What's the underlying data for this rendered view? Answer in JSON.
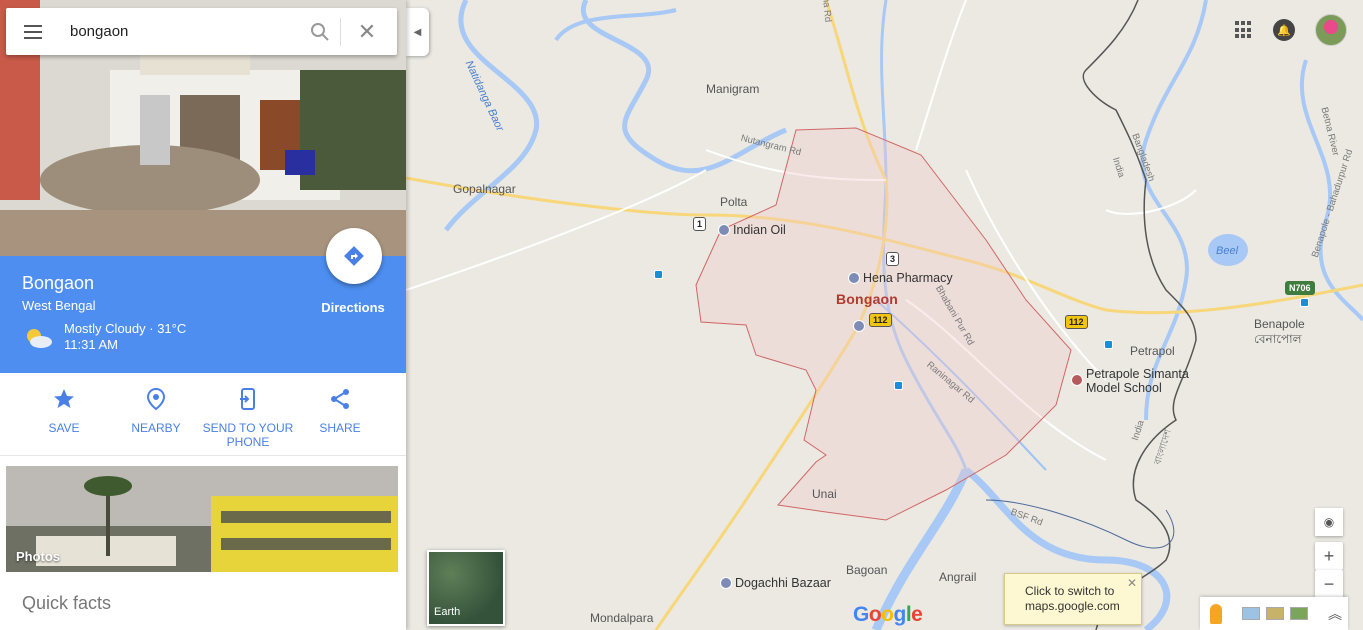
{
  "search": {
    "value": "bongaon"
  },
  "place": {
    "name": "Bongaon",
    "region": "West Bengal",
    "weather": "Mostly Cloudy · 31°C",
    "time": "11:31 AM",
    "directions_label": "Directions"
  },
  "actions": [
    {
      "label": "SAVE",
      "icon": "star-icon"
    },
    {
      "label": "NEARBY",
      "icon": "nearby-icon"
    },
    {
      "label": "SEND TO YOUR PHONE",
      "icon": "send-to-phone-icon"
    },
    {
      "label": "SHARE",
      "icon": "share-icon"
    }
  ],
  "photos_label": "Photos",
  "quick_facts": "Quick facts",
  "map": {
    "labels": {
      "manigram": "Manigram",
      "gopalnagar": "Gopalnagar",
      "polta": "Polta",
      "indian_oil": "Indian Oil",
      "hena_pharmacy": "Hena Pharmacy",
      "bongaon": "Bongaon",
      "unai": "Unai",
      "bagoan": "Bagoan",
      "angrail": "Angrail",
      "dogachhi_bazaar": "Dogachhi Bazaar",
      "mondalpara": "Mondalpara",
      "petrapol": "Petrapol",
      "petrapole_school_1": "Petrapole Simanta",
      "petrapole_school_2": "Model School",
      "benapole": "Benapole",
      "benapole_bn": "বেনাপোল",
      "beel": "Beel",
      "nutangram_rd": "Nutangram Rd",
      "natidanga_baor": "Natidanga Baor",
      "bhabani_pur_rd": "Bhabani Pur Rd",
      "raninagar_rd": "Raninagar Rd",
      "bsf_rd": "BSF Rd",
      "india_1": "India",
      "india_2": "India",
      "bangladesh": "Bangladesh",
      "betna_river": "Betna River",
      "benapole_rd": "Benapole - Bahadurpur Rd",
      "bangladesh_bn": "বাংলাদেশ",
      "ha_rd": "ha Rd"
    },
    "shields": {
      "r1": "1",
      "r3": "3",
      "r112a": "112",
      "r112b": "112",
      "n706": "N706"
    },
    "earth_label": "Earth",
    "google_logo": "Google",
    "tooltip": {
      "line1": "Click to switch to",
      "line2": "maps.google.com"
    }
  },
  "colors": {
    "panel_blue": "#4d8ef0",
    "action_blue": "#4a80e6",
    "city_red": "#b03a2e"
  }
}
